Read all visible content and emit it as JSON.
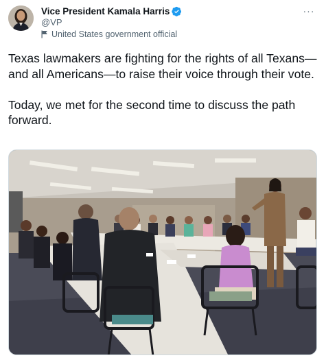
{
  "author": {
    "display_name": "Vice President Kamala Harris",
    "handle": "@VP",
    "verified_icon": "verified-badge-icon",
    "label": "United States government official",
    "label_icon": "flag-icon"
  },
  "more_icon": "more-horizontal-icon",
  "tweet": {
    "text": "Texas lawmakers are fighting for the rights of all Texans—and all Americans—to raise their voice through their vote.\n\nToday, we met for the second time to discuss the path forward."
  },
  "media": {
    "type": "photo"
  },
  "colors": {
    "text_primary": "#0f1419",
    "text_secondary": "#536471",
    "verified_blue": "#1d9bf0",
    "border": "#cfd9de"
  }
}
